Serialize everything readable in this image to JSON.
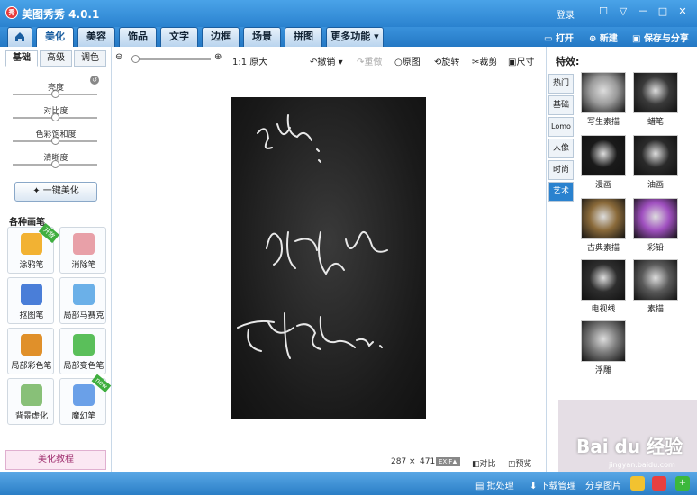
{
  "window": {
    "title": "美图秀秀 4.0.1",
    "login": "登录",
    "minimize": "－",
    "restore": "□",
    "close": "✕",
    "msg": "☐",
    "shirt": "▽"
  },
  "tabs": [
    {
      "label": "美化"
    },
    {
      "label": "美容"
    },
    {
      "label": "饰品"
    },
    {
      "label": "文字"
    },
    {
      "label": "边框"
    },
    {
      "label": "场景"
    },
    {
      "label": "拼图"
    },
    {
      "label": "更多功能"
    }
  ],
  "top_actions": {
    "open": "打开",
    "new": "新建",
    "save": "保存与分享"
  },
  "left": {
    "subtabs": [
      "基础",
      "高级",
      "调色"
    ],
    "sliders": [
      {
        "label": "亮度",
        "value": 0.5
      },
      {
        "label": "对比度",
        "value": 0.5
      },
      {
        "label": "色彩饱和度",
        "value": 0.5
      },
      {
        "label": "清晰度",
        "value": 0.5
      }
    ],
    "one_click": "一键美化",
    "brushes_title": "各种画笔",
    "tools": [
      {
        "label": "涂鸦笔",
        "badge": "开放",
        "color": "#f2b233"
      },
      {
        "label": "消除笔",
        "badge": "",
        "color": "#e8a0a8"
      },
      {
        "label": "抠图笔",
        "badge": "",
        "color": "#4a7ed8"
      },
      {
        "label": "局部马赛克",
        "badge": "",
        "color": "#6bb0e8"
      },
      {
        "label": "局部彩色笔",
        "badge": "",
        "color": "#e0902a"
      },
      {
        "label": "局部变色笔",
        "badge": "",
        "color": "#5abf5a"
      },
      {
        "label": "背景虚化",
        "badge": "",
        "color": "#88c078"
      },
      {
        "label": "魔幻笔",
        "badge": "new",
        "color": "#6aa0e8"
      }
    ],
    "tutorial": "美化教程"
  },
  "toolbar": {
    "zoom_label": "1:1 原大",
    "undo": "撤销",
    "redo": "重做",
    "original": "原图",
    "rotate": "旋转",
    "crop": "裁剪",
    "resize": "尺寸"
  },
  "status": {
    "width": "287",
    "times": "×",
    "height": "471",
    "exif": "EXIF▲",
    "compare": "对比",
    "preview": "预览"
  },
  "right": {
    "title": "特效:",
    "categories": [
      "热门",
      "基础",
      "Lomo",
      "人像",
      "时尚",
      "艺术"
    ],
    "active_category": "艺术",
    "effects": [
      {
        "label": "写生素描",
        "tint": "#9a9a9a"
      },
      {
        "label": "蜡笔",
        "tint": "#3a3a3a"
      },
      {
        "label": "漫画",
        "tint": "#1a1a1a"
      },
      {
        "label": "油画",
        "tint": "#2a2a2a"
      },
      {
        "label": "古典素描",
        "tint": "#8a6a3a"
      },
      {
        "label": "彩铅",
        "tint": "#a050c0"
      },
      {
        "label": "电视线",
        "tint": "#2e2e2e"
      },
      {
        "label": "素描",
        "tint": "#5a5a5a"
      },
      {
        "label": "浮雕",
        "tint": "#7a7a7a"
      }
    ]
  },
  "bottom": {
    "batch": "批处理",
    "download": "下载管理",
    "share": "分享图片"
  },
  "watermark": {
    "brand": "Bai du 经验",
    "url": "jingyan.baidu.com"
  }
}
